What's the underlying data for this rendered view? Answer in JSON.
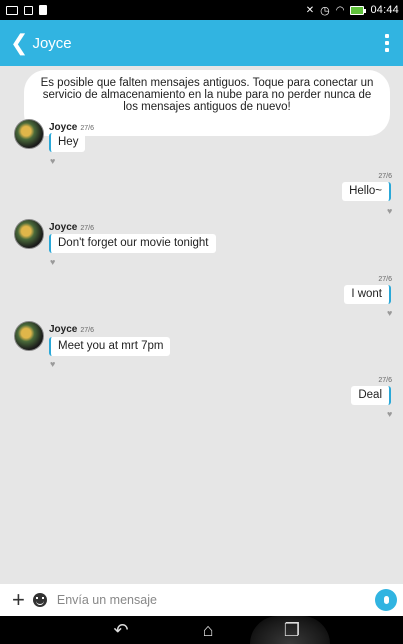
{
  "status_bar": {
    "time": "04:44",
    "icons": [
      "screenshot-icon",
      "sd-card-icon",
      "document-icon",
      "mute-icon",
      "alarm-icon",
      "wifi-icon",
      "battery-icon"
    ]
  },
  "header": {
    "title": "Joyce",
    "back_icon": "chevron-left-icon",
    "menu_icon": "overflow-menu-icon"
  },
  "notice": {
    "text": "Es posible que falten mensajes antiguos. Toque para conectar un servicio de almacenamiento en la nube para no perder nunca de los mensajes antiguos de nuevo!"
  },
  "messages": [
    {
      "direction": "in",
      "sender": "Joyce",
      "date": "27/6",
      "text": "Hey"
    },
    {
      "direction": "out",
      "date": "27/6",
      "text": "Hello~"
    },
    {
      "direction": "in",
      "sender": "Joyce",
      "date": "27/6",
      "text": "Don't forget our movie tonight"
    },
    {
      "direction": "out",
      "date": "27/6",
      "text": "I wont"
    },
    {
      "direction": "in",
      "sender": "Joyce",
      "date": "27/6",
      "text": "Meet you at mrt 7pm"
    },
    {
      "direction": "out",
      "date": "27/6",
      "text": "Deal"
    }
  ],
  "composer": {
    "placeholder": "Envía un mensaje"
  },
  "colors": {
    "accent": "#31b4e1",
    "background": "#e6e6e6"
  }
}
